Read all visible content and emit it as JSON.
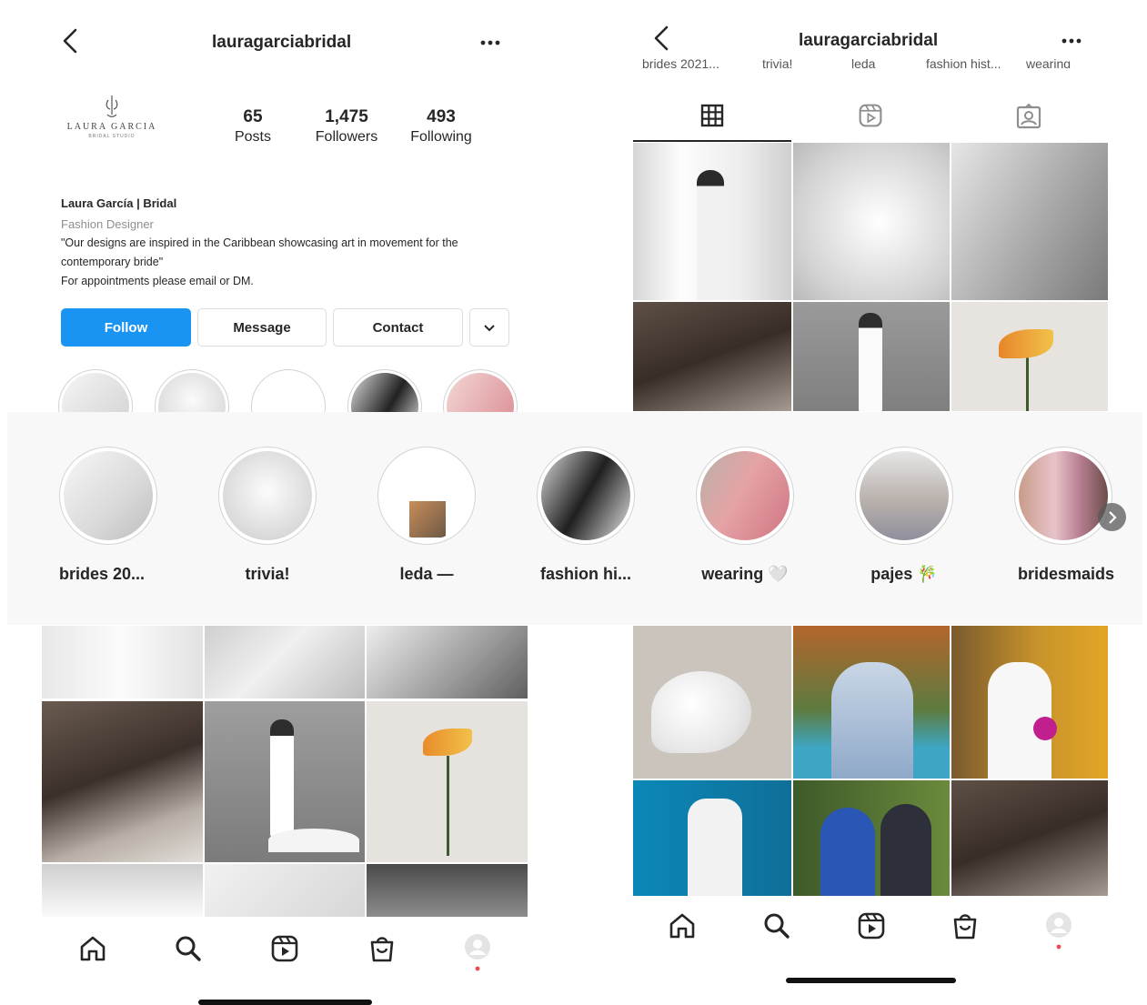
{
  "left": {
    "username": "lauragarciabridal",
    "logo": {
      "name": "LAURA GARCIA",
      "sub": "BRIDAL STUDIO"
    },
    "stats": [
      {
        "value": "65",
        "label": "Posts"
      },
      {
        "value": "1,475",
        "label": "Followers"
      },
      {
        "value": "493",
        "label": "Following"
      }
    ],
    "bio": {
      "name": "Laura García | Bridal",
      "category": "Fashion Designer",
      "line1": "\"Our designs are inspired in the Caribbean showcasing art in movement for the",
      "line2": "contemporary bride\"",
      "line3": "For appointments please email or DM."
    },
    "buttons": {
      "follow": "Follow",
      "message": "Message",
      "contact": "Contact"
    }
  },
  "right": {
    "username": "lauragarciabridal",
    "clipped_labels": [
      "brides 2021...",
      "trivia!",
      "leda",
      "fashion hist...",
      "wearing"
    ]
  },
  "highlights": [
    {
      "label": "brides 20..."
    },
    {
      "label": "trivia!"
    },
    {
      "label": "leda —"
    },
    {
      "label": "fashion hi..."
    },
    {
      "label": "wearing 🤍"
    },
    {
      "label": "pajes 🎋"
    },
    {
      "label": "bridesmaids"
    }
  ],
  "colors": {
    "accent": "#1a94f2",
    "text": "#262626",
    "muted": "#8e8e8e",
    "notification": "#ed4956"
  },
  "icons": [
    "back-arrow-icon",
    "more-icon",
    "grid-icon",
    "reels-icon",
    "tagged-icon",
    "home-icon",
    "search-icon",
    "shop-icon",
    "profile-icon",
    "chevron-down-icon",
    "chevron-right-icon"
  ]
}
